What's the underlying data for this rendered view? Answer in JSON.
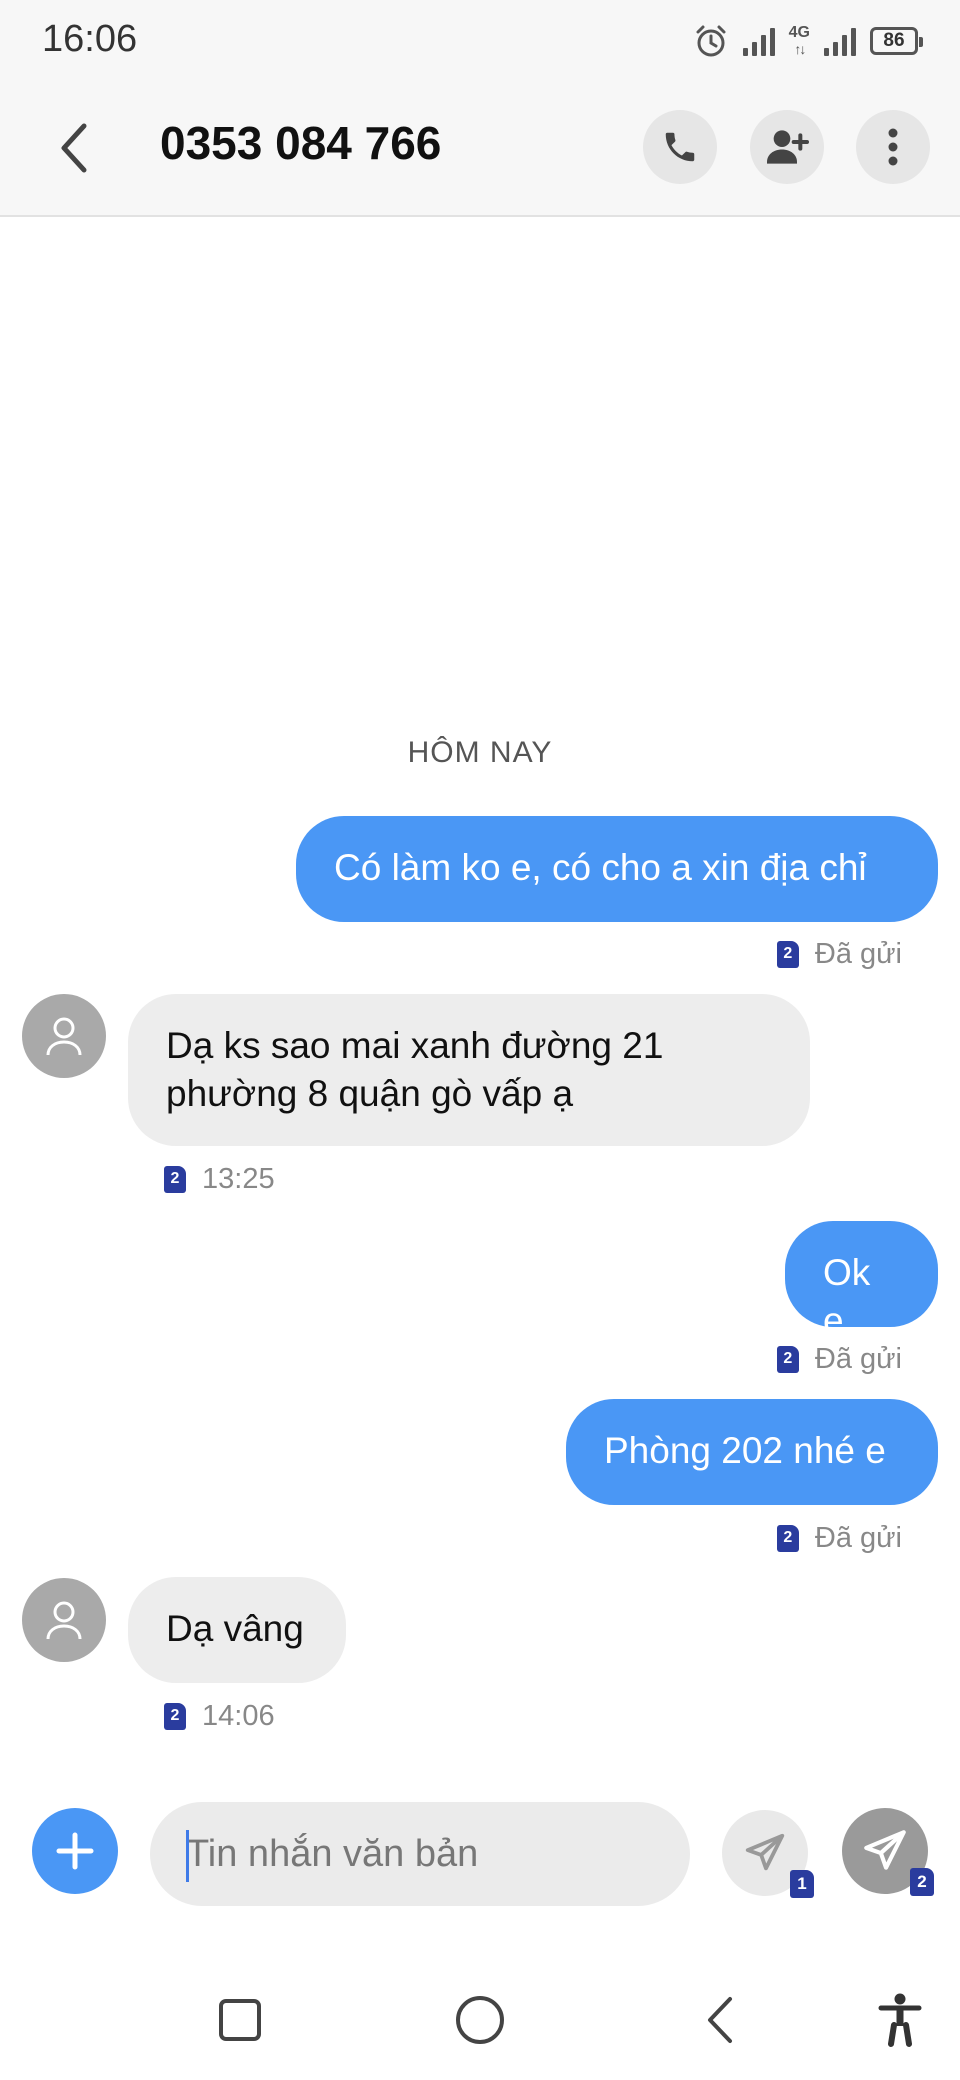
{
  "status_bar": {
    "time": "16:06",
    "network_type": "4G",
    "battery": "86"
  },
  "header": {
    "title": "0353 084 766",
    "icons": [
      "back-icon",
      "phone-icon",
      "add-contact-icon",
      "more-icon"
    ]
  },
  "conversation": {
    "date_separator": "HÔM NAY",
    "messages": [
      {
        "direction": "out",
        "text": "Có làm ko e, có cho a xin địa chỉ",
        "sim": "2",
        "status": "Đã gửi"
      },
      {
        "direction": "in",
        "text": "Dạ ks sao mai xanh đường 21 phường 8 quận gò vấp ạ",
        "sim": "2",
        "time": "13:25"
      },
      {
        "direction": "out",
        "text": "Ok e",
        "sim": "2",
        "status": "Đã gửi"
      },
      {
        "direction": "out",
        "text": "Phòng 202 nhé e",
        "sim": "2",
        "status": "Đã gửi"
      },
      {
        "direction": "in",
        "text": "Dạ vâng",
        "sim": "2",
        "time": "14:06"
      }
    ]
  },
  "composer": {
    "placeholder": "Tin nhắn văn bản",
    "send_sim1": "1",
    "send_sim2": "2"
  },
  "colors": {
    "accent": "#4a97f5",
    "incoming_bubble": "#ededed",
    "sim_badge": "#2a3c9e"
  }
}
